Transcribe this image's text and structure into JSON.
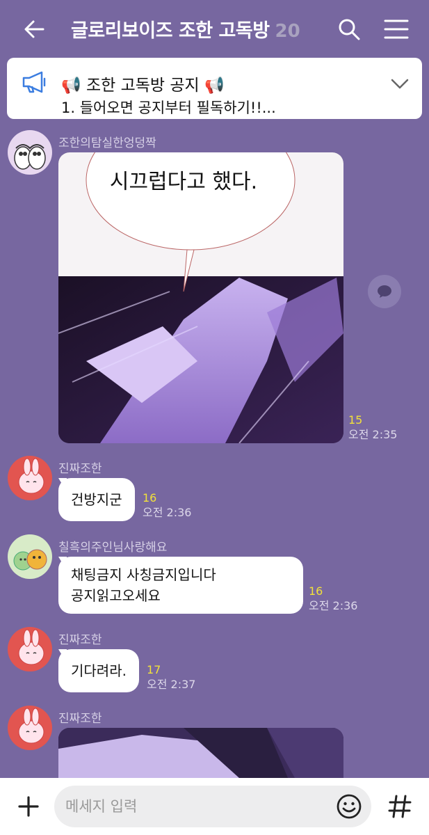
{
  "header": {
    "title": "글로리보이즈 조한 고독방",
    "member_count": "20"
  },
  "notice": {
    "title": "📢 조한 고독방 공지 📢",
    "body": "1. 들어오면 공지부터 필독하기!!..."
  },
  "messages": [
    {
      "sender": "조한의탐실한엉덩짝",
      "type": "image",
      "image_caption": "시끄럽다고 했다.",
      "read_count": "15",
      "time": "오전 2:35"
    },
    {
      "sender": "진짜조한",
      "type": "text",
      "lines": [
        "건방지군"
      ],
      "read_count": "16",
      "time": "오전 2:36"
    },
    {
      "sender": "칠흑의주인님사랑해요",
      "type": "text",
      "lines": [
        "채팅금지 사칭금지입니다",
        "공지읽고오세요"
      ],
      "read_count": "16",
      "time": "오전 2:36"
    },
    {
      "sender": "진짜조한",
      "type": "text",
      "lines": [
        "기다려라."
      ],
      "read_count": "17",
      "time": "오전 2:37"
    },
    {
      "sender": "진짜조한",
      "type": "image"
    }
  ],
  "input": {
    "placeholder": "메세지 입력"
  },
  "icons": {
    "back": "back-arrow-icon",
    "search": "search-icon",
    "menu": "hamburger-menu-icon",
    "notice": "megaphone-icon",
    "chevron": "chevron-down-icon",
    "share": "speech-bubble-icon",
    "plus": "plus-icon",
    "emoji": "smiley-icon",
    "hash": "hash-icon"
  },
  "colors": {
    "background": "#7767a0",
    "read_count": "#f2e13a",
    "time": "#ddd8ea",
    "sender": "#d6d0e6"
  }
}
